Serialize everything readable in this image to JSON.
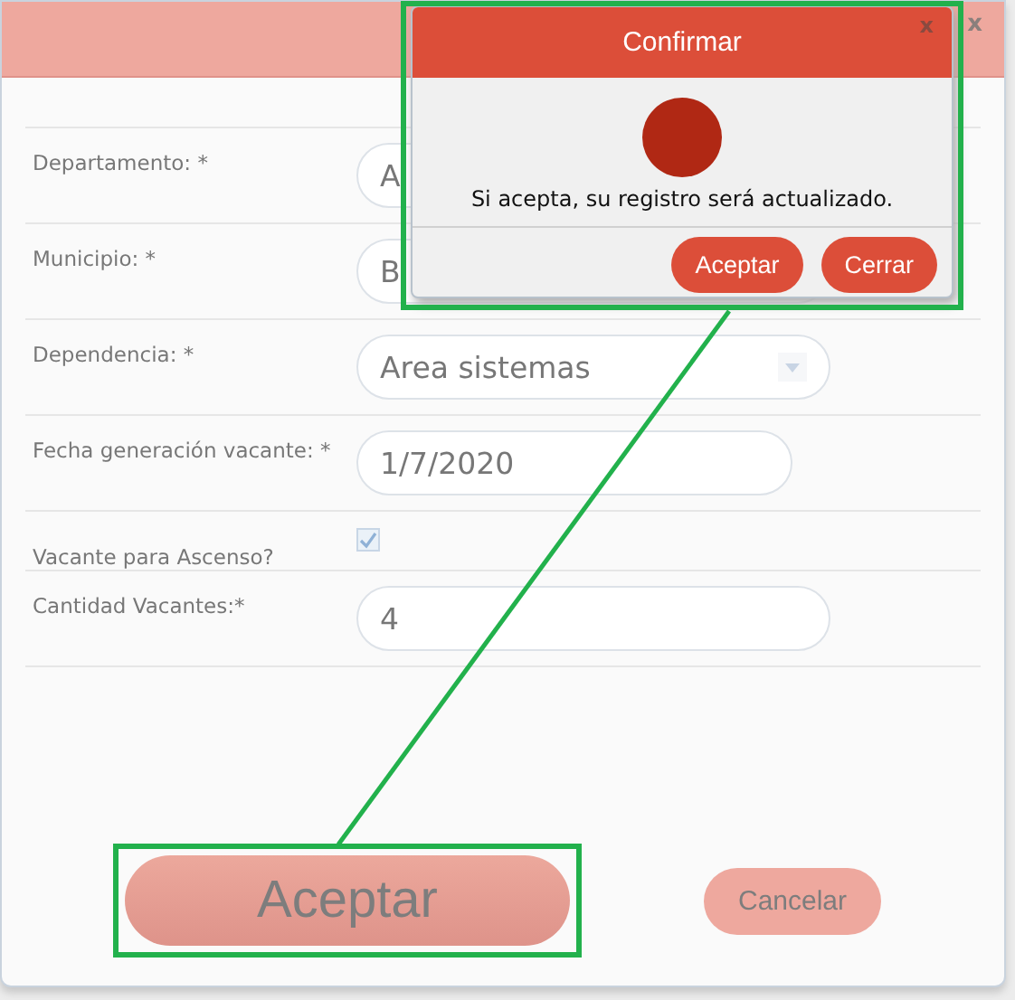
{
  "dialog": {
    "close": "x"
  },
  "fields": [
    {
      "label": "Departamento: *",
      "kind": "text",
      "value": "A"
    },
    {
      "label": "Municipio: *",
      "kind": "text",
      "value": "B"
    },
    {
      "label": "Dependencia: *",
      "kind": "select",
      "value": "Area sistemas"
    },
    {
      "label": "Fecha generación vacante: *",
      "kind": "date",
      "value": "1/7/2020"
    },
    {
      "label": "Vacante para Ascenso?",
      "kind": "checkbox",
      "checked": true
    },
    {
      "label": "Cantidad Vacantes:*",
      "kind": "text",
      "value": "4"
    }
  ],
  "buttons": [
    {
      "label": "Aceptar",
      "kind": "primary"
    },
    {
      "label": "Cancelar",
      "kind": "secondary"
    }
  ],
  "confirm": {
    "title": "Confirmar",
    "close": "x",
    "message": "Si acepta, su registro será actualizado.",
    "buttons": [
      {
        "label": "Aceptar"
      },
      {
        "label": "Cerrar"
      }
    ]
  }
}
